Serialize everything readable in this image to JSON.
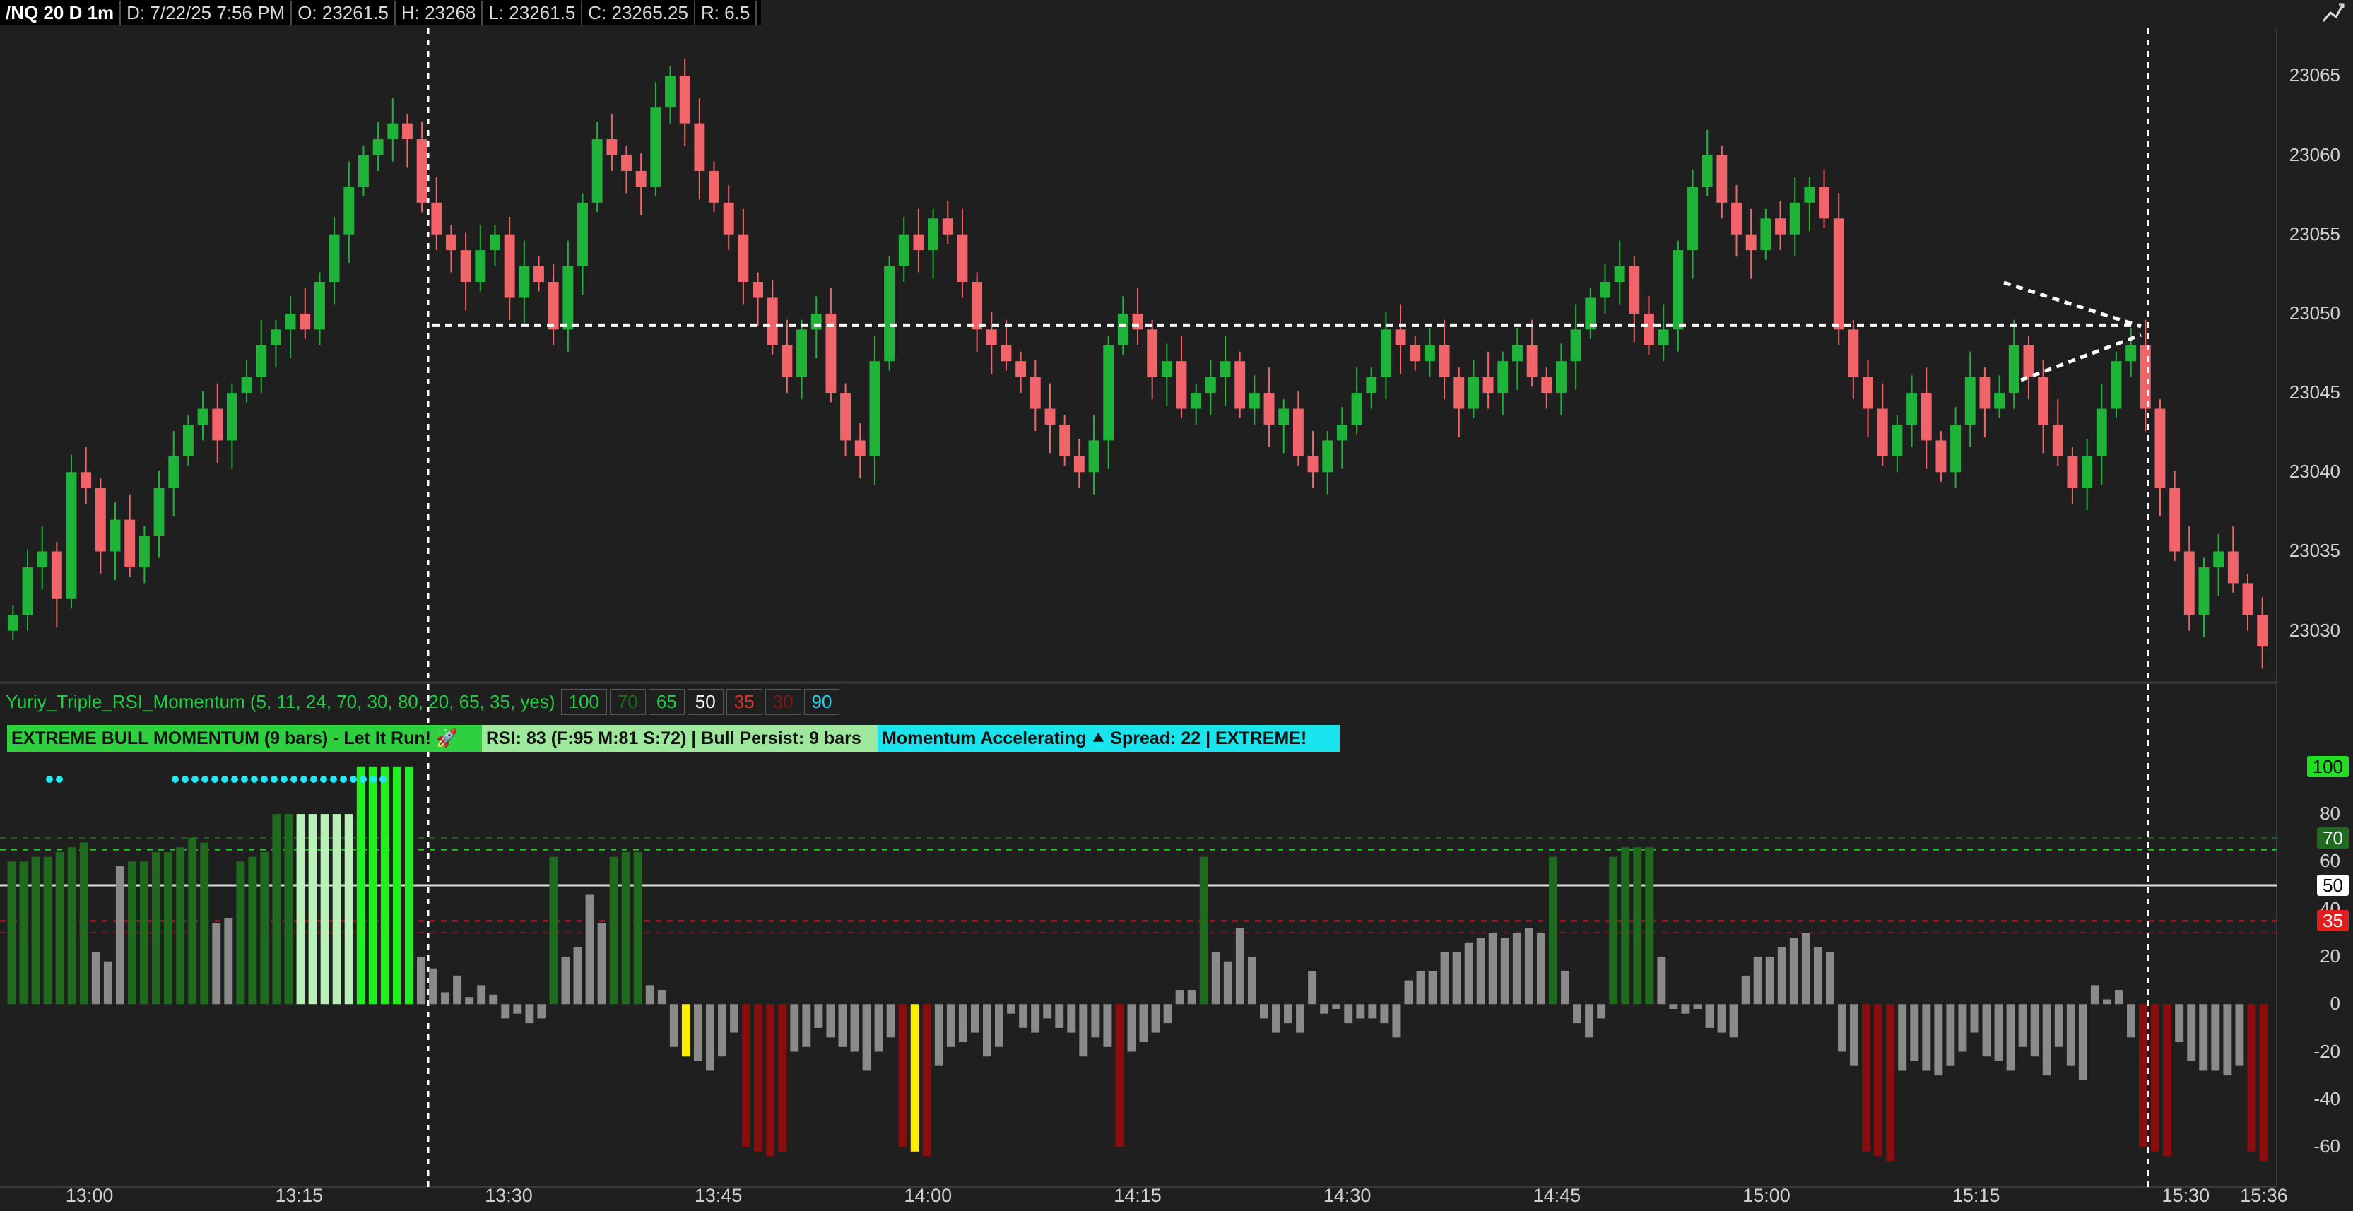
{
  "header": {
    "symbol": "/NQ 20 D 1m",
    "date": "D: 7/22/25 7:56 PM",
    "open": "O: 23261.5",
    "high": "H: 23268",
    "low": "L: 23261.5",
    "close": "C: 23265.25",
    "range": "R: 6.5",
    "tool_icon": "drawing-tool-icon"
  },
  "price_axis": {
    "ticks": [
      "23065",
      "23060",
      "23055",
      "23050",
      "23045",
      "23040",
      "23035",
      "23030"
    ]
  },
  "time_axis": {
    "ticks": [
      "13:00",
      "13:15",
      "13:30",
      "13:45",
      "14:00",
      "14:15",
      "14:30",
      "14:45",
      "15:00",
      "15:15",
      "15:30",
      "15:36"
    ]
  },
  "study": {
    "name": "Yuriy_Triple_RSI_Momentum (5, 11, 24, 70, 30, 80, 20, 65, 35, yes)",
    "levels": [
      {
        "text": "100",
        "color": "#22cc44"
      },
      {
        "text": "70",
        "color": "#1f6a1f"
      },
      {
        "text": "65",
        "color": "#22cc44"
      },
      {
        "text": "50",
        "color": "#ffffff"
      },
      {
        "text": "35",
        "color": "#e03030"
      },
      {
        "text": "30",
        "color": "#7a1a1a"
      },
      {
        "text": "90",
        "color": "#22d4f0"
      }
    ],
    "labels": [
      {
        "text": "EXTREME BULL MOMENTUM (9 bars) - Let It Run! 🚀",
        "bg": "#2fd040"
      },
      {
        "text": "RSI: 83 (F:95 M:81 S:72) | Bull Persist: 9 bars",
        "bg": "#9ee89e"
      },
      {
        "text": "Momentum Accelerating ⯅ Spread: 22 | EXTREME!",
        "bg": "#19e5ee"
      }
    ]
  },
  "osc_axis": {
    "ticks": [
      "80",
      "60",
      "40",
      "20",
      "0",
      "-20",
      "-40",
      "-60"
    ],
    "badges": [
      {
        "text": "100",
        "bg": "#22dd22",
        "fg": "#000000"
      },
      {
        "text": "70",
        "bg": "#1f6a1f",
        "fg": "#ffffff"
      },
      {
        "text": "50",
        "bg": "#ffffff",
        "fg": "#000000"
      },
      {
        "text": "35",
        "bg": "#e02020",
        "fg": "#ffffff"
      }
    ]
  },
  "colors": {
    "up_candle": "#1fb33a",
    "down_candle": "#f0646a",
    "background": "#1f1f1f",
    "dark_green_bar": "#1f6a1f",
    "bright_green_bar": "#22ee22",
    "pale_green_bar": "#b8f0b8",
    "grey_bar": "#8a8a8a",
    "dark_red_bar": "#8a0e0e",
    "yellow_bar": "#ffee00",
    "cyan_dot": "#22e8f8"
  },
  "chart_data": {
    "type": "candlestick",
    "price_range": [
      23027,
      23068
    ],
    "time_range": [
      "12:54",
      "15:36"
    ],
    "reference_line": 23049,
    "candles_sample_hint": "approximate OHLC sequence of 1-minute NQ bars",
    "closes": [
      23031,
      23034,
      23035,
      23032,
      23040,
      23039,
      23035,
      23037,
      23034,
      23036,
      23039,
      23041,
      23043,
      23044,
      23042,
      23045,
      23046,
      23048,
      23049,
      23050,
      23049,
      23052,
      23055,
      23058,
      23060,
      23061,
      23062,
      23061,
      23057,
      23055,
      23054,
      23052,
      23054,
      23055,
      23051,
      23053,
      23052,
      23049,
      23053,
      23057,
      23061,
      23060,
      23059,
      23058,
      23063,
      23065,
      23062,
      23059,
      23057,
      23055,
      23052,
      23051,
      23048,
      23046,
      23049,
      23050,
      23045,
      23042,
      23041,
      23047,
      23053,
      23055,
      23054,
      23056,
      23055,
      23052,
      23049,
      23048,
      23047,
      23046,
      23044,
      23043,
      23041,
      23040,
      23042,
      23048,
      23050,
      23049,
      23046,
      23047,
      23044,
      23045,
      23046,
      23047,
      23044,
      23045,
      23043,
      23044,
      23041,
      23040,
      23042,
      23043,
      23045,
      23046,
      23049,
      23048,
      23047,
      23048,
      23046,
      23044,
      23046,
      23045,
      23047,
      23048,
      23046,
      23045,
      23047,
      23049,
      23051,
      23052,
      23053,
      23050,
      23048,
      23049,
      23054,
      23058,
      23060,
      23057,
      23055,
      23054,
      23056,
      23055,
      23057,
      23058,
      23056,
      23049,
      23046,
      23044,
      23041,
      23043,
      23045,
      23042,
      23040,
      23043,
      23046,
      23044,
      23045,
      23048,
      23046,
      23043,
      23041,
      23039,
      23041,
      23044,
      23047,
      23048,
      23044,
      23039,
      23035,
      23031,
      23034,
      23035,
      23033,
      23031,
      23029
    ],
    "oscillator": {
      "type": "bar",
      "ylim": [
        -68,
        105
      ],
      "levels": [
        100,
        70,
        65,
        50,
        35,
        30
      ],
      "values": [
        60,
        60,
        62,
        62,
        64,
        66,
        68,
        22,
        18,
        58,
        60,
        60,
        64,
        64,
        66,
        70,
        68,
        34,
        36,
        60,
        62,
        64,
        80,
        80,
        80,
        80,
        80,
        80,
        80,
        100,
        100,
        100,
        100,
        100,
        20,
        15,
        5,
        12,
        3,
        8,
        4,
        -6,
        -4,
        -8,
        -6,
        62,
        20,
        24,
        46,
        34,
        62,
        64,
        64,
        8,
        6,
        -18,
        -22,
        -24,
        -28,
        -22,
        -12,
        -60,
        -62,
        -64,
        -62,
        -20,
        -18,
        -10,
        -14,
        -18,
        -20,
        -28,
        -20,
        -14,
        -60,
        -62,
        -64,
        -26,
        -18,
        -16,
        -12,
        -22,
        -18,
        -4,
        -10,
        -12,
        -6,
        -10,
        -12,
        -22,
        -14,
        -18,
        -60,
        -20,
        -16,
        -12,
        -8,
        6,
        6,
        62,
        22,
        18,
        32,
        20,
        -6,
        -12,
        -8,
        -12,
        14,
        -4,
        -2,
        -8,
        -6,
        -6,
        -8,
        -14,
        10,
        14,
        14,
        22,
        22,
        26,
        28,
        30,
        28,
        30,
        32,
        30,
        62,
        14,
        -8,
        -14,
        -6,
        62,
        66,
        66,
        66,
        20,
        -2,
        -4,
        -2,
        -10,
        -12,
        -14,
        12,
        20,
        20,
        24,
        28,
        30,
        24,
        22,
        -20,
        -26,
        -62,
        -64,
        -66,
        -28,
        -24,
        -28,
        -30,
        -26,
        -20,
        -12,
        -22,
        -24,
        -28,
        -18,
        -22,
        -30,
        -18,
        -26,
        -32,
        8,
        2,
        6,
        -14,
        -60,
        -62,
        -64,
        -16,
        -24,
        -28,
        -28,
        -30,
        -26,
        -62,
        -66
      ],
      "cyan_dots_at": [
        80,
        80
      ]
    }
  }
}
